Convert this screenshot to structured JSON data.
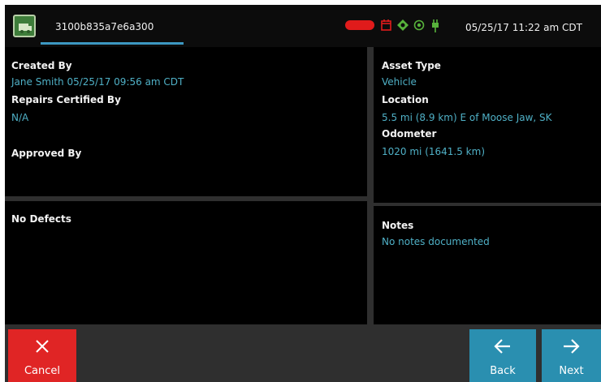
{
  "header": {
    "tab_title": "3100b835a7e6a300",
    "datetime": "05/25/17 11:22 am CDT",
    "status_icons": [
      "battery-red-icon",
      "calendar-icon",
      "location-pin-icon",
      "gps-icon",
      "plug-icon"
    ],
    "colors": {
      "accent": "#3d98c2",
      "battery": "#e01b1b",
      "status_green": "#57b23b"
    }
  },
  "details": {
    "created_by_label": "Created By",
    "created_by_value": "Jane Smith 05/25/17 09:56 am CDT",
    "repairs_label": "Repairs Certified By",
    "repairs_value": "N/A",
    "approved_label": "Approved By"
  },
  "asset": {
    "type_label": "Asset Type",
    "type_value": "Vehicle",
    "location_label": "Location",
    "location_value": "5.5 mi (8.9 km) E of Moose Jaw, SK",
    "odometer_label": "Odometer",
    "odometer_value": "1020 mi (1641.5 km)"
  },
  "defects": {
    "label": "No Defects"
  },
  "notes": {
    "label": "Notes",
    "value": "No notes documented"
  },
  "footer": {
    "cancel_label": "Cancel",
    "back_label": "Back",
    "next_label": "Next",
    "colors": {
      "cancel": "#e02525",
      "nav": "#2a8fb0",
      "value_text": "#4fb0c6"
    }
  }
}
